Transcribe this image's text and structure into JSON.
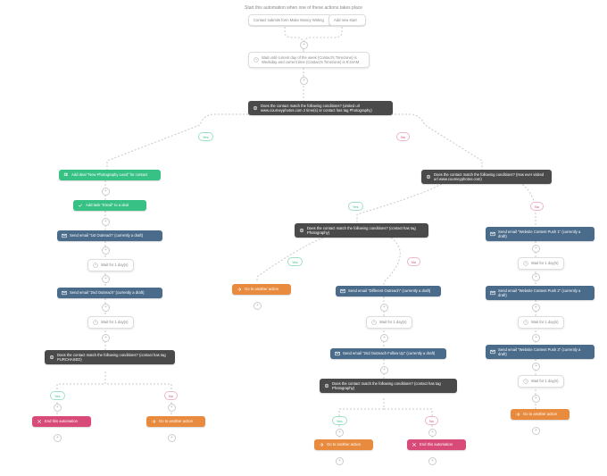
{
  "header": {
    "start_text": "Start this automation when one of these actions takes place"
  },
  "labels": {
    "yes": "Yes",
    "no": "No"
  },
  "triggers": {
    "t1": "Contact submits form Make Money Writing",
    "t2": "Add new start"
  },
  "waits": {
    "w_top": "Wait until current day of the week (Contact's Timezone) is Weekday and current time (Contact's Timezone) is 9:34AM",
    "w_1d": "Wait for 1 day(s)"
  },
  "conds": {
    "c_root": "Does the contact match the following conditions? (visited url www.courneyphotos.com 2 time(s) or contact has tag Photography)",
    "c_right": "Does the contact match the following conditions? (Has ever visited url www.courneyphotos.com)",
    "c_mid": "Does the contact match the following conditions? (contact has tag Photography)",
    "c_purchased": "Does the contact match the following conditions? (contact has tag PURCHASED)",
    "c_mid2": "Does the contact match the following conditions? (contact has tag Photography)"
  },
  "actions": {
    "add_deal": "Add deal \"New Photography Lead\" for contact",
    "add_task": "Add task \"Email\" to a deal",
    "email_1st": "Send email \"1st Outreach\" (currently a draft)",
    "email_2nd": "Send email \"2nd Outreach\" (currently a draft)",
    "email_diff": "Send email \"Different Outreach\" (currently a draft)",
    "email_2nd_follow": "Send email \"2nd Outreach Follow Up\" (currently a draft)",
    "push1": "Send email \"Website Content Push 1\" (currently a draft)",
    "push2": "Send email \"Website Content Push 2\" (currently a draft)",
    "push3": "Send email \"Website Content Push 3\" (currently a draft)",
    "goto": "Go to another action",
    "end": "End this automation"
  },
  "icons": {
    "clock": "clock",
    "cond": "cond",
    "deal": "deal",
    "task": "task",
    "email": "email",
    "goto": "goto",
    "end": "end",
    "plus": "+"
  }
}
